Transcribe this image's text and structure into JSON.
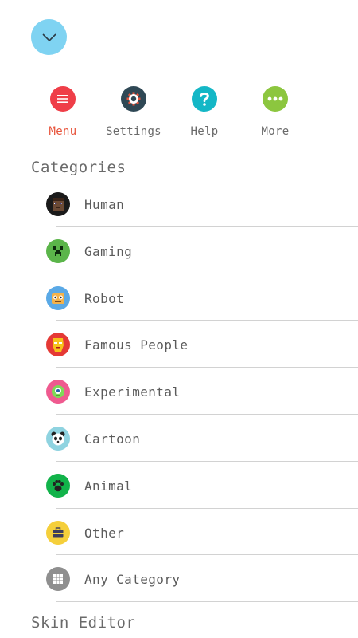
{
  "colors": {
    "accent": "#e8553d",
    "collapse_button": "#7fd3f2",
    "menu": "#ef3e48",
    "settings": "#2f4855",
    "help": "#14b7c6",
    "more": "#8cc63f"
  },
  "header": {
    "collapse_icon": "chevron-down-icon"
  },
  "toolbar": {
    "items": [
      {
        "label": "Menu",
        "icon": "hamburger-menu-icon",
        "active": true
      },
      {
        "label": "Settings",
        "icon": "gear-icon",
        "active": false
      },
      {
        "label": "Help",
        "icon": "question-mark-icon",
        "active": false
      },
      {
        "label": "More",
        "icon": "more-dots-icon",
        "active": false
      }
    ]
  },
  "sections": {
    "categories_title": "Categories",
    "skin_editor_title": "Skin Editor"
  },
  "categories": [
    {
      "label": "Human",
      "icon": "human-face-icon",
      "color": "#1a1a1a"
    },
    {
      "label": "Gaming",
      "icon": "creeper-face-icon",
      "color": "#5bb54a"
    },
    {
      "label": "Robot",
      "icon": "robot-face-icon",
      "color": "#5aa9e6"
    },
    {
      "label": "Famous People",
      "icon": "iron-helmet-icon",
      "color": "#e53935"
    },
    {
      "label": "Experimental",
      "icon": "one-eyed-monster-icon",
      "color": "#ef5a8f"
    },
    {
      "label": "Cartoon",
      "icon": "panda-face-icon",
      "color": "#8fd3e0"
    },
    {
      "label": "Animal",
      "icon": "paw-print-icon",
      "color": "#12b34a"
    },
    {
      "label": "Other",
      "icon": "briefcase-icon",
      "color": "#f5cf3b"
    },
    {
      "label": "Any Category",
      "icon": "grid-icon",
      "color": "#8f8f8f"
    }
  ]
}
